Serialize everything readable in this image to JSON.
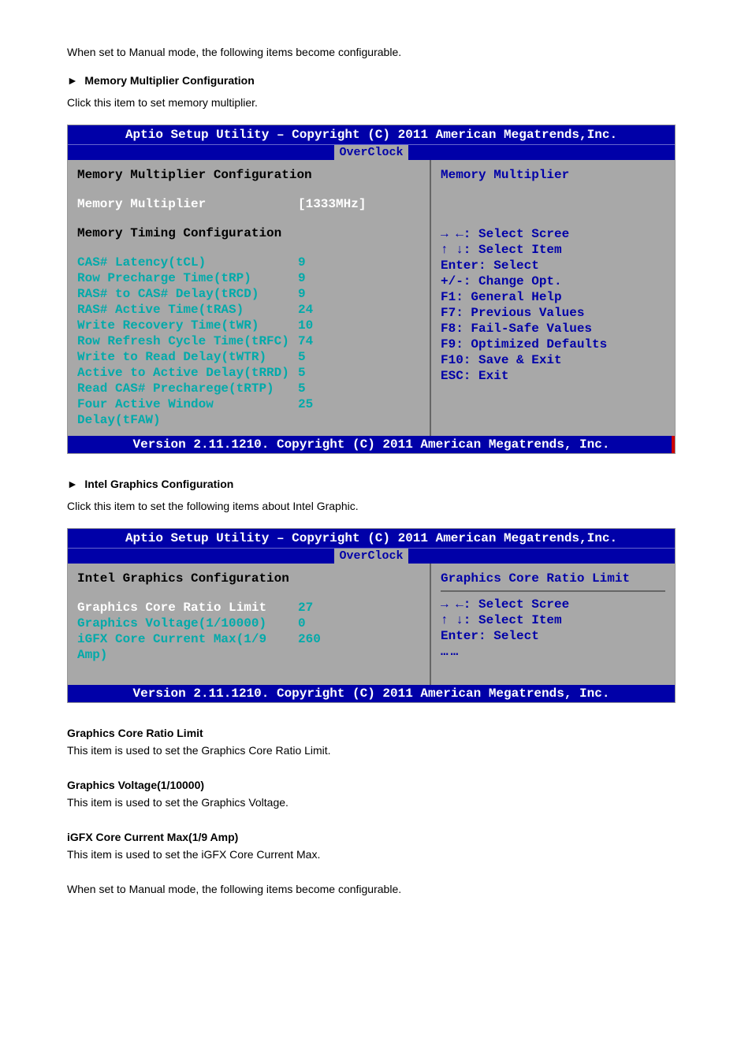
{
  "top_text": "When set to Manual mode, the following items become configurable.",
  "section1": {
    "arrow": "►",
    "title": "Memory Multiplier Configuration",
    "desc": "Click this item to set memory multiplier."
  },
  "bios1": {
    "header": "Aptio Setup Utility – Copyright (C) 2011 American Megatrends,Inc.",
    "tab": "OverClock",
    "heading1": "Memory Multiplier Configuration",
    "mult_row": {
      "label": "Memory Multiplier",
      "value": "[1333MHz]"
    },
    "heading2": "Memory Timing Configuration",
    "rows": [
      {
        "label": "CAS# Latency(tCL)",
        "value": "9"
      },
      {
        "label": "Row Precharge Time(tRP)",
        "value": "9"
      },
      {
        "label": "RAS# to CAS# Delay(tRCD)",
        "value": "9"
      },
      {
        "label": "RAS# Active Time(tRAS)",
        "value": "24"
      },
      {
        "label": "Write Recovery Time(tWR)",
        "value": "10"
      },
      {
        "label": "Row Refresh Cycle Time(tRFC)",
        "value": "74"
      },
      {
        "label": "Write to Read Delay(tWTR)",
        "value": "5"
      },
      {
        "label": "Active to Active Delay(tRRD)",
        "value": "5"
      },
      {
        "label": "Read CAS# Precharege(tRTP)",
        "value": "5"
      },
      {
        "label": "Four Active Window Delay(tFAW)",
        "value": "25"
      }
    ],
    "help_title": "Memory Multiplier",
    "help_lines": [
      "→ ←: Select Scree",
      "↑ ↓: Select Item",
      "Enter: Select",
      "+/-:  Change Opt.",
      "F1: General Help",
      "F7: Previous Values",
      "F8: Fail-Safe Values",
      "F9: Optimized Defaults",
      "F10: Save & Exit",
      "ESC: Exit"
    ],
    "footer": "Version 2.11.1210. Copyright (C) 2011 American Megatrends, Inc."
  },
  "section2": {
    "arrow": "►",
    "title": "Intel Graphics Configuration",
    "desc": "Click this item to set the following items about Intel Graphic."
  },
  "bios2": {
    "header": "Aptio Setup Utility – Copyright (C) 2011 American Megatrends,Inc.",
    "tab": "OverClock",
    "heading": "Intel Graphics Configuration",
    "rows": [
      {
        "label": "Graphics Core Ratio Limit",
        "value": "27"
      },
      {
        "label": "Graphics Voltage(1/10000)",
        "value": "0"
      },
      {
        "label": "iGFX Core Current Max(1/9 Amp)",
        "value": "260"
      }
    ],
    "help_title": "Graphics Core Ratio Limit",
    "help_lines": [
      "→ ←: Select Scree",
      "↑ ↓: Select Item",
      "Enter: Select"
    ],
    "dots": "……",
    "footer": "Version 2.11.1210. Copyright (C) 2011 American Megatrends, Inc."
  },
  "bottom_settings": [
    {
      "title": "Graphics Core Ratio Limit",
      "desc": "This item is used to set the Graphics Core Ratio Limit."
    },
    {
      "title": "Graphics Voltage(1/10000)",
      "desc": "This item is used to set the Graphics Voltage."
    },
    {
      "title": "iGFX Core Current Max(1/9 Amp)",
      "desc": "This item is used to set the iGFX Core Current Max."
    }
  ],
  "bottom_text": "When set to Manual mode, the following items become configurable."
}
